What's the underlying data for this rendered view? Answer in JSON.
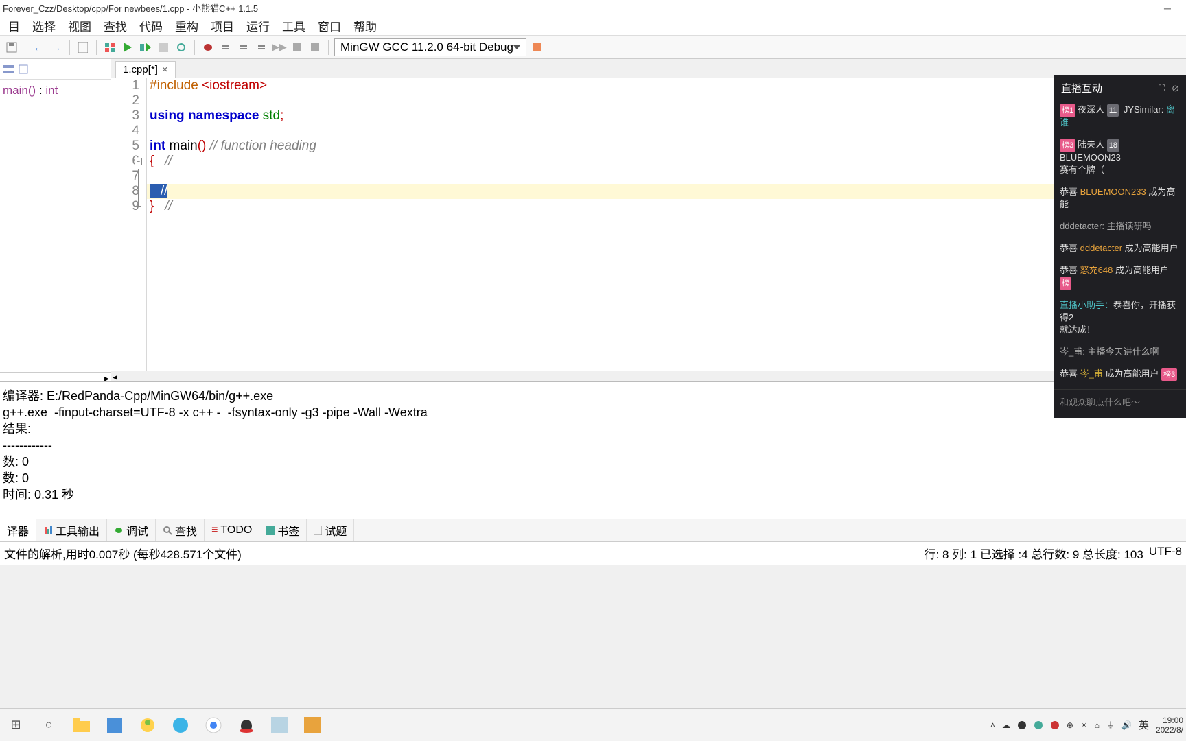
{
  "title": "Forever_Czz/Desktop/cpp/For newbees/1.cpp  - 小熊猫C++ 1.1.5",
  "menu": [
    "目",
    "选择",
    "视图",
    "查找",
    "代码",
    "重构",
    "项目",
    "运行",
    "工具",
    "窗口",
    "帮助"
  ],
  "compiler_select": "MinGW GCC 11.2.0 64-bit Debug",
  "tree_item": {
    "fn": "main()",
    "sep": " : ",
    "type": "int"
  },
  "tab": {
    "label": "1.cpp[*]",
    "close": "×"
  },
  "code_lines": [
    "1",
    "2",
    "3",
    "4",
    "5",
    "6",
    "7",
    "8",
    "9"
  ],
  "code": {
    "l1a": "#include ",
    "l1b": "<iostream>",
    "l3a": "using ",
    "l3b": "namespace ",
    "l3c": "std",
    "l3d": ";",
    "l5a": "int ",
    "l5b": "main",
    "l5c": "()",
    "l5d": " // function heading",
    "l6a": "{",
    "l6b": "   //",
    "l8": "   //",
    "l9a": "}",
    "l9b": "   //"
  },
  "chat": {
    "title": "直播互动",
    "rank1": "榜1",
    "user1": "夜深人",
    "lvl1": "11",
    "tail1": "JYSimilar:",
    "msg1": "离谁",
    "rank2": "榜3",
    "user2": "陆夫人",
    "lvl2": "18",
    "tail2": "BLUEMOON23",
    "line2": "赛有个牌（",
    "c1a": "恭喜 ",
    "c1b": "BLUEMOON233",
    "c1c": " 成为高能",
    "d1": "dddetacter: 主播读研吗",
    "c2a": "恭喜 ",
    "c2b": "dddetacter",
    "c2c": " 成为高能用户",
    "c3a": "恭喜 ",
    "c3b": "怒充648",
    "c3c": " 成为高能用户 ",
    "c3d": "榜",
    "h1a": "直播小助手：",
    "h1b": "恭喜你，开播获得2",
    "h1c": "就达成！",
    "q1": "岑_甫: 主播今天讲什么啊",
    "c4a": "恭喜 ",
    "c4b": "岑_甫",
    "c4c": " 成为高能用户 ",
    "c4d": "榜3",
    "input": "和观众聊点什么吧～"
  },
  "output": {
    "l1": "编译器: E:/RedPanda-Cpp/MinGW64/bin/g++.exe",
    "l2": "g++.exe  -finput-charset=UTF-8 -x c++ -  -fsyntax-only -g3 -pipe -Wall -Wextra",
    "l3": "",
    "l4": "结果:",
    "l5": "------------",
    "l6": "数: 0",
    "l7": "数: 0",
    "l8": "时间: 0.31 秒"
  },
  "bottom_tabs": [
    "译器",
    "工具输出",
    "调试",
    "查找",
    "TODO",
    "书签",
    "试题"
  ],
  "parse_status": "文件的解析,用时0.007秒 (每秒428.571个文件)",
  "status_right": {
    "pos": "行: 8 列: 1 已选择 :4 总行数: 9 总长度: 103",
    "enc": "UTF-8"
  },
  "taskbar": {
    "ime": "英",
    "time": "19:00",
    "date": "2022/8/"
  }
}
